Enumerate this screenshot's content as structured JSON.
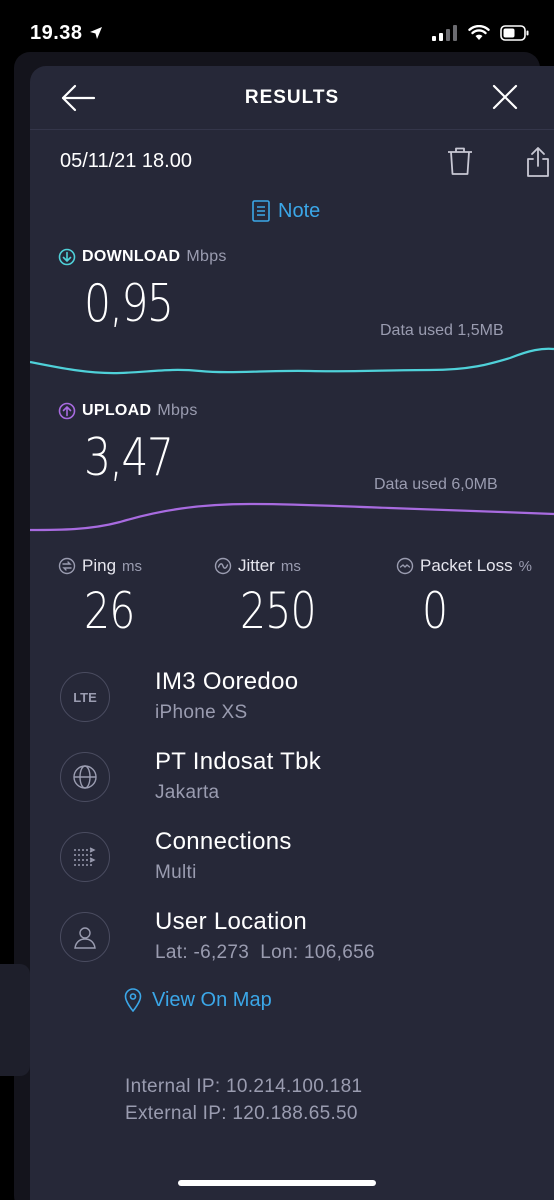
{
  "status_bar": {
    "time": "19.38"
  },
  "header": {
    "title": "RESULTS"
  },
  "result": {
    "datetime": "05/11/21 18.00",
    "note_label": "Note"
  },
  "download": {
    "label": "DOWNLOAD",
    "unit": "Mbps",
    "value": "0,95",
    "data_used": "Data used 1,5MB",
    "color": "#4fd1d9"
  },
  "upload": {
    "label": "UPLOAD",
    "unit": "Mbps",
    "value": "3,47",
    "data_used": "Data used 6,0MB",
    "color": "#a86be0"
  },
  "ping": {
    "label": "Ping",
    "unit": "ms",
    "value": "26"
  },
  "jitter": {
    "label": "Jitter",
    "unit": "ms",
    "value": "250"
  },
  "packet_loss": {
    "label": "Packet Loss",
    "unit": "%",
    "value": "0"
  },
  "provider": {
    "icon_text": "LTE",
    "title": "IM3 Ooredoo",
    "subtitle": "iPhone XS"
  },
  "server": {
    "title": "PT Indosat Tbk",
    "subtitle": "Jakarta"
  },
  "connections": {
    "title": "Connections",
    "subtitle": "Multi"
  },
  "location": {
    "title": "User Location",
    "subtitle": "Lat: -6,273  Lon: 106,656",
    "map_label": "View On Map"
  },
  "network": {
    "internal_ip": "Internal IP: 10.214.100.181",
    "external_ip": "External IP: 120.188.65.50"
  },
  "accent_color": "#3ba7e8"
}
